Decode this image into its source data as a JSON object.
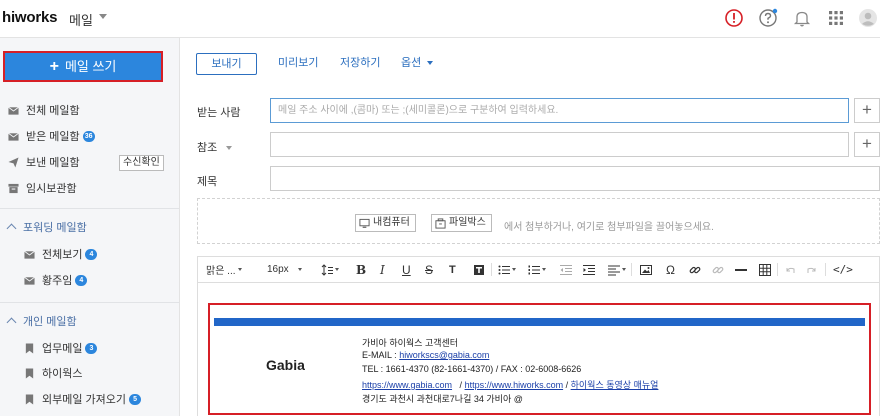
{
  "header": {
    "logo": "hiworks",
    "app_name": "메일",
    "icons": [
      "alert-circle-icon",
      "help-circle-icon",
      "bell-icon",
      "apps-grid-icon",
      "user-avatar-icon"
    ],
    "colors": {
      "alert": "#d61f26",
      "notify_dot": "#2c86dd"
    }
  },
  "sidebar": {
    "compose_label": "메일 쓰기",
    "items": [
      {
        "label": "전체 메일함",
        "icon": "mailbox-icon"
      },
      {
        "label": "받은 메일함",
        "icon": "inbox-icon",
        "badge": "36"
      },
      {
        "label": "보낸 메일함",
        "icon": "send-icon",
        "action": "수신확인"
      },
      {
        "label": "임시보관함",
        "icon": "drafts-icon"
      }
    ],
    "groups": [
      {
        "label": "포워딩 메일함",
        "items": [
          {
            "label": "전체보기",
            "badge": "4",
            "icon": "mail-icon"
          },
          {
            "label": "황주임",
            "badge": "4",
            "icon": "mail-icon"
          }
        ]
      },
      {
        "label": "개인 메일함",
        "items": [
          {
            "label": "업무메일",
            "badge": "3",
            "icon": "bookmark-icon"
          },
          {
            "label": "하이웍스",
            "icon": "bookmark-icon"
          },
          {
            "label": "외부메일 가져오기",
            "badge": "5",
            "icon": "bookmark-icon"
          }
        ]
      }
    ],
    "colors": {
      "accent": "#2c86dd",
      "highlight_border": "#d61f26"
    }
  },
  "toolbar": {
    "send": "보내기",
    "preview": "미리보기",
    "save": "저장하기",
    "options": "옵션"
  },
  "form": {
    "to_label": "받는 사람",
    "to_placeholder": "메일 주소 사이에 ,(콤마) 또는 ;(세미콜론)으로 구분하여 입력하세요.",
    "cc_label": "참조",
    "subject_label": "제목"
  },
  "attach": {
    "my_pc": "내컴퓨터",
    "file_box": "파일박스",
    "hint": "에서 첨부하거나, 여기로 첨부파일을 끌어놓으세요."
  },
  "editor_toolbar": {
    "font": "맑은 ...",
    "size": "16px",
    "tools": [
      "line-height-icon",
      "bold-icon",
      "italic-icon",
      "underline-icon",
      "strikethrough-icon",
      "text-color-icon",
      "background-color-icon",
      "bullet-list-icon",
      "numbered-list-icon",
      "outdent-icon",
      "indent-icon",
      "align-icon",
      "image-icon",
      "special-char-icon",
      "link-icon",
      "unlink-icon",
      "horizontal-rule-icon",
      "table-icon",
      "undo-icon",
      "redo-icon",
      "source-code-icon"
    ]
  },
  "signature": {
    "logo": "Gabia",
    "line1": "가비아 하이웍스 고객센터",
    "email_label": "E-MAIL : ",
    "email": "hiworkscs@gabia.com",
    "tel": "TEL : 1661-4370 (82-1661-4370) / FAX : 02-6008-6626",
    "url1": "https://www.gabia.com",
    "url2": "https://www.hiworks.com",
    "video_manual": "하이웍스 동영상 매뉴얼",
    "address": "경기도 과천시 과천대로7나길 34 가비아 @",
    "bar_color": "#2166c8",
    "border_color": "#d61f26"
  }
}
